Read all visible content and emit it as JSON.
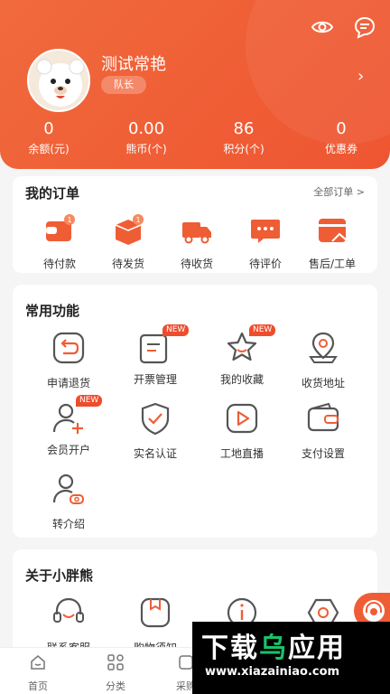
{
  "profile": {
    "username": "测试常艳",
    "role": "队长",
    "avatar_text": "Bear"
  },
  "stats": [
    {
      "value": "0",
      "label": "余额(元)"
    },
    {
      "value": "0.00",
      "label": "熊币(个)"
    },
    {
      "value": "86",
      "label": "积分(个)"
    },
    {
      "value": "0",
      "label": "优惠券"
    }
  ],
  "orders": {
    "title": "我的订单",
    "all_label": "全部订单 >",
    "items": [
      {
        "label": "待付款",
        "icon": "wallet-icon",
        "badge": "1"
      },
      {
        "label": "待发货",
        "icon": "box-icon",
        "badge": "1"
      },
      {
        "label": "待收货",
        "icon": "truck-icon"
      },
      {
        "label": "待评价",
        "icon": "chat-dots-icon"
      },
      {
        "label": "售后/工单",
        "icon": "aftersale-icon"
      }
    ]
  },
  "functions": {
    "title": "常用功能",
    "new_tag": "NEW",
    "items": [
      {
        "label": "申请退货",
        "icon": "return-icon"
      },
      {
        "label": "开票管理",
        "icon": "invoice-icon",
        "new": true
      },
      {
        "label": "我的收藏",
        "icon": "star-icon",
        "new": true
      },
      {
        "label": "收货地址",
        "icon": "location-icon"
      },
      {
        "label": "会员开户",
        "icon": "add-member-icon",
        "new": true
      },
      {
        "label": "实名认证",
        "icon": "shield-check-icon"
      },
      {
        "label": "工地直播",
        "icon": "play-icon"
      },
      {
        "label": "支付设置",
        "icon": "wallet-settings-icon"
      },
      {
        "label": "转介绍",
        "icon": "referral-icon"
      }
    ]
  },
  "about": {
    "title": "关于小胖熊",
    "items": [
      {
        "label": "联系客服",
        "icon": "headset-icon"
      },
      {
        "label": "购物须知",
        "icon": "notice-icon"
      },
      {
        "label": "",
        "icon": "info-icon"
      },
      {
        "label": "",
        "icon": "hexagon-icon"
      }
    ]
  },
  "tabs": [
    {
      "label": "首页",
      "icon": "home-icon"
    },
    {
      "label": "分类",
      "icon": "grid-icon"
    },
    {
      "label": "采购",
      "icon": "purchase-icon"
    }
  ],
  "watermark": {
    "big_left": "下载",
    "big_accent": "乌",
    "big_right": "应用",
    "url": "www.xiazainiao.com"
  },
  "colors": {
    "brand": "#ef5d35",
    "new_tag": "#ee4d2d"
  }
}
